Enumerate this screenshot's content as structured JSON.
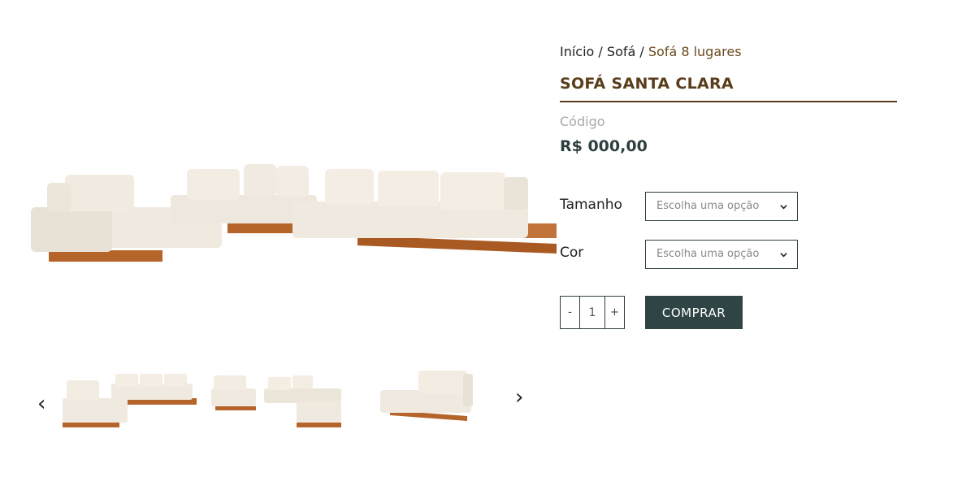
{
  "breadcrumb": {
    "home": "Início",
    "sep1": " / ",
    "category": "Sofá",
    "sep2": " / ",
    "current": "Sofá  8 lugares"
  },
  "product": {
    "title": "SOFÁ SANTA CLARA",
    "code_label": "Código",
    "price": "R$ 000,00"
  },
  "options": {
    "size_label": "Tamanho",
    "size_placeholder": "Escolha uma opção",
    "color_label": "Cor",
    "color_placeholder": "Escolha uma opção"
  },
  "quantity": {
    "minus": "-",
    "value": "1",
    "plus": "+"
  },
  "buy_label": "COMPRAR",
  "gallery": {
    "prev_icon": "‹",
    "next_icon": "›"
  },
  "colors": {
    "brand_brown": "#5a3e1b",
    "button_dark": "#2f4444",
    "fabric": "#efe9e0",
    "wood": "#b5652a"
  }
}
